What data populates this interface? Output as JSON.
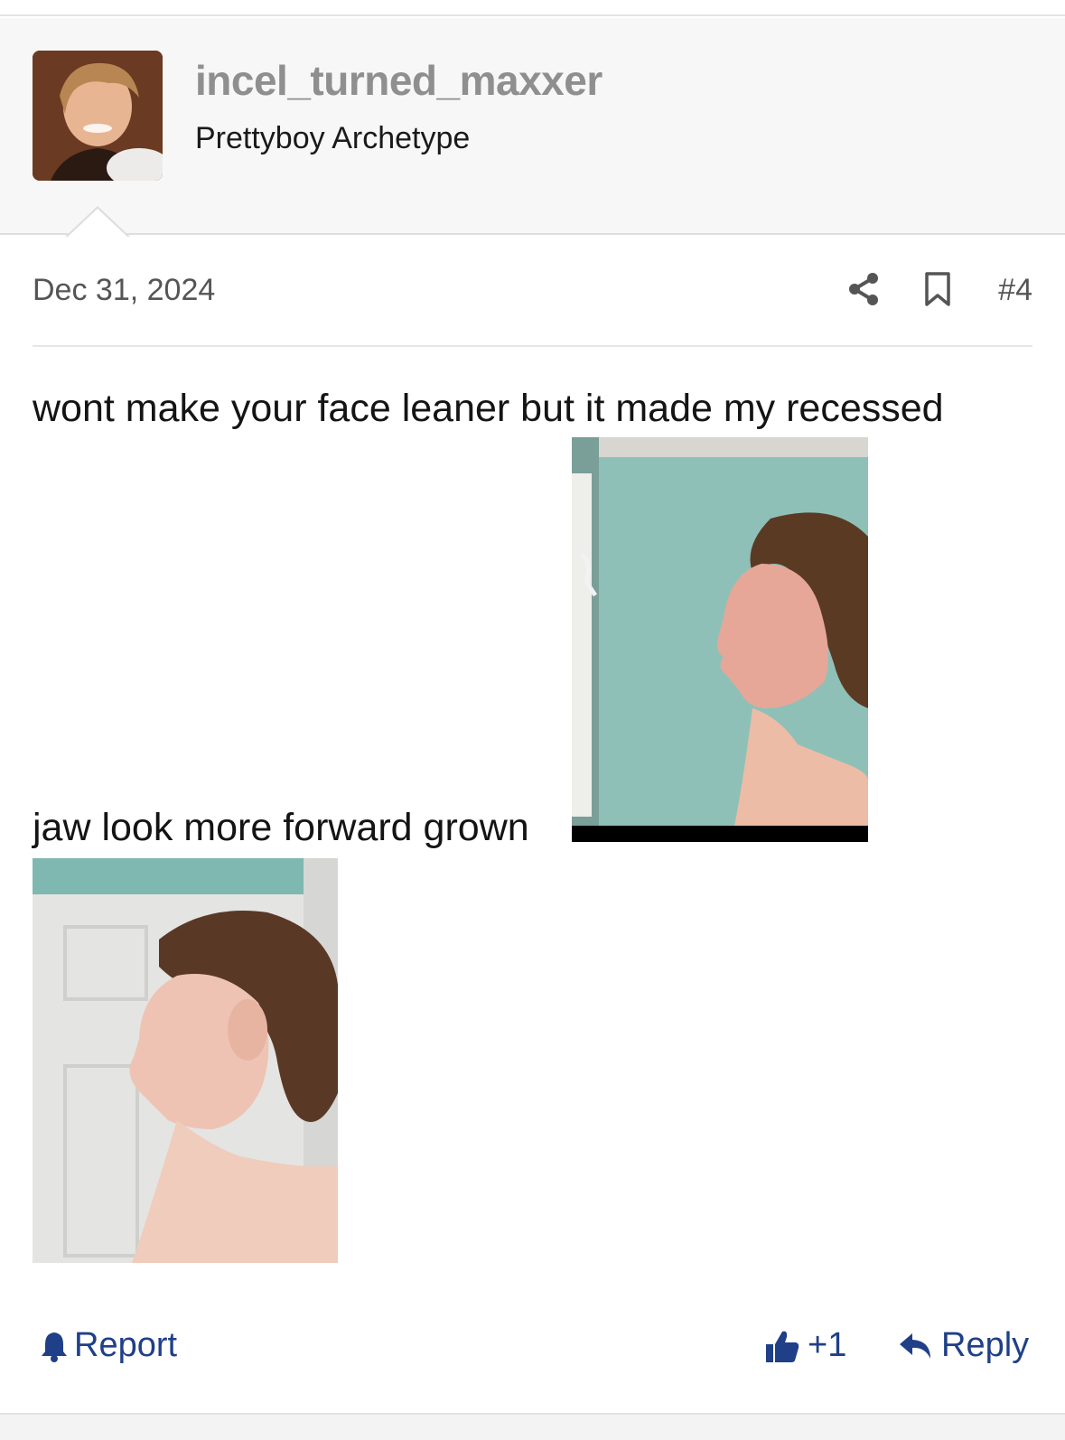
{
  "post": {
    "author": {
      "username": "incel_turned_maxxer",
      "title": "Prettyboy Archetype",
      "avatar_icon": "avatar-photo"
    },
    "date": "Dec 31, 2024",
    "number": "#4",
    "body": {
      "line1": "wont make your face leaner but it made my recessed",
      "line2": "jaw look more forward grown"
    },
    "actions": {
      "report": "Report",
      "like": "+1",
      "reply": "Reply"
    }
  },
  "colors": {
    "link": "#1f3f88",
    "username": "#8f8f8f",
    "header_bg": "#f7f7f7",
    "wall_teal": "#8fc0b8"
  }
}
